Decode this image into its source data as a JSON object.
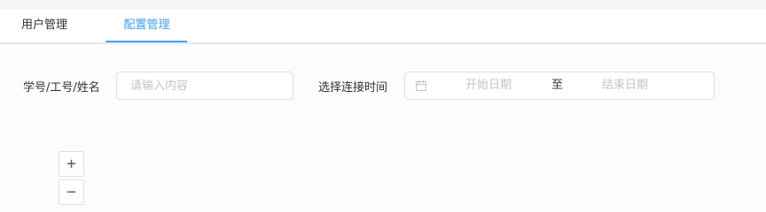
{
  "tabs": [
    {
      "label": "用户管理",
      "active": false
    },
    {
      "label": "配置管理",
      "active": true
    }
  ],
  "filters": {
    "id_label": "学号/工号/姓名",
    "id_placeholder": "请输入内容",
    "time_label": "选择连接时间",
    "start_placeholder": "开始日期",
    "separator": "至",
    "end_placeholder": "结束日期"
  },
  "zoom": {
    "in_label": "+",
    "out_label": "−"
  },
  "colors": {
    "accent": "#409eff",
    "border": "#dcdfe6",
    "placeholder": "#c0c4cc",
    "text": "#303133"
  },
  "icons": {
    "date_range": "calendar-icon"
  }
}
